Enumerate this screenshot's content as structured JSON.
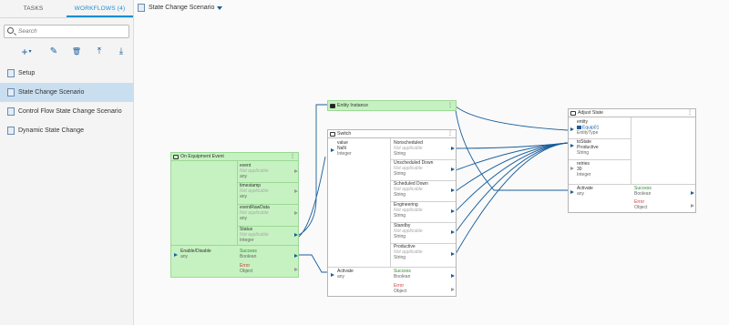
{
  "tabs": {
    "tasks": "TASKS",
    "workflows": "WORKFLOWS (4)"
  },
  "search": {
    "placeholder": "Search"
  },
  "toolbar": {
    "add": "+",
    "add_menu": "▾",
    "edit": "✎",
    "delete": "🗑",
    "move_top": "⤒",
    "move_bottom": "⤓"
  },
  "workflows": [
    {
      "label": "Setup"
    },
    {
      "label": "State Change Scenario"
    },
    {
      "label": "Control Flow State Change Scenario"
    },
    {
      "label": "Dynamic State Change"
    }
  ],
  "header": {
    "title": "State Change Scenario"
  },
  "nodes": {
    "equipment_event": {
      "title": "On Equipment Event",
      "outputs": [
        {
          "name": "event",
          "value": "Not applicable",
          "type": "any"
        },
        {
          "name": "timestamp",
          "value": "Not applicable",
          "type": "any"
        },
        {
          "name": "eventRawData",
          "value": "Not applicable",
          "type": "any"
        },
        {
          "name": "Status",
          "value": "Not applicable",
          "type": "Integer"
        }
      ],
      "input": {
        "name": "Enable/Disable",
        "type": "any"
      },
      "success": {
        "name": "Success",
        "type": "Boolean"
      },
      "error": {
        "name": "Error",
        "type": "Object"
      }
    },
    "entity_instance": {
      "title": "Entity Instance"
    },
    "switch": {
      "title": "Switch",
      "value_in": {
        "name": "value",
        "value": "NaN",
        "type": "Integer"
      },
      "cases": [
        {
          "name": "Nonscheduled",
          "value": "Not applicable",
          "type": "String"
        },
        {
          "name": "Unscheduled Down",
          "value": "Not applicable",
          "type": "String"
        },
        {
          "name": "Scheduled Down",
          "value": "Not applicable",
          "type": "String"
        },
        {
          "name": "Engineering",
          "value": "Not applicable",
          "type": "String"
        },
        {
          "name": "Standby",
          "value": "Not applicable",
          "type": "String"
        },
        {
          "name": "Productive",
          "value": "Not applicable",
          "type": "String"
        }
      ],
      "activate": {
        "name": "Activate",
        "type": "any"
      },
      "success": {
        "name": "Success",
        "type": "Boolean"
      },
      "error": {
        "name": "Error",
        "type": "Object"
      }
    },
    "adjust_state": {
      "title": "Adjust State",
      "entity": {
        "name": "entity",
        "value": "Equip01",
        "type": "EntityType"
      },
      "to_state": {
        "name": "toState",
        "value": "Productive",
        "type": "String"
      },
      "retries": {
        "name": "retries",
        "value": "30",
        "type": "Integer"
      },
      "activate": {
        "name": "Activate",
        "type": "any"
      },
      "success": {
        "name": "Success",
        "type": "Boolean"
      },
      "error": {
        "name": "Error",
        "type": "Object"
      }
    }
  },
  "colors": {
    "accent": "#1a8fd1",
    "wire": "#1a5e9a",
    "node_green": "#c6f2c1",
    "success": "#2e8b2e",
    "error": "#d03a3a"
  }
}
